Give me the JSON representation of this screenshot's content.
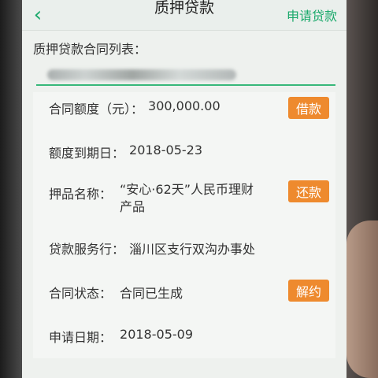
{
  "header": {
    "back_icon": "chevron-left-icon",
    "title": "质押贷款",
    "apply_label": "申请贷款"
  },
  "list": {
    "title": "质押贷款合同列表："
  },
  "contract": {
    "amount_label": "合同额度（元）：",
    "amount_value": "300,000.00",
    "borrow_btn": "借款",
    "expiry_label": "额度到期日：",
    "expiry_value": "2018-05-23",
    "pledge_label": "押品名称：",
    "pledge_value": "“安心·62天”人民币理财产品",
    "repay_btn": "还款",
    "branch_label": "贷款服务行：",
    "branch_value": "淄川区支行双沟办事处",
    "status_label": "合同状态：",
    "status_value": "合同已生成",
    "cancel_btn": "解约",
    "apply_date_label": "申请日期：",
    "apply_date_value": "2018-05-09"
  },
  "colors": {
    "accent": "#1aa96b",
    "button": "#ee8a2e"
  }
}
